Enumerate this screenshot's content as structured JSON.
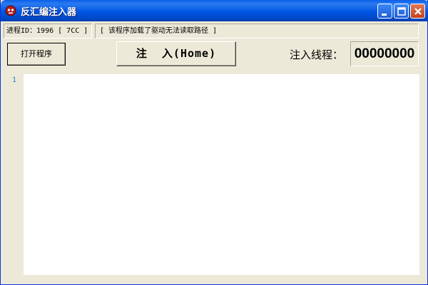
{
  "window": {
    "title": "反汇编注入器",
    "controls": {
      "minimize": "minimize-icon",
      "maximize": "maximize-icon",
      "close": "close-icon"
    }
  },
  "status": {
    "process_id": "进程ID：1996 [ 7CC ]",
    "message": "[ 该程序加载了驱动无法读取路径 ]"
  },
  "toolbar": {
    "open_label": "打开程序",
    "inject_label": "注  入(Home)",
    "thread_label": "注入线程：",
    "thread_value": "00000000"
  },
  "editor": {
    "line_numbers": [
      "1"
    ],
    "content": ""
  },
  "colors": {
    "titlebar": "#0054e3",
    "window_bg": "#ece9d8",
    "editor_bg": "#ffffff",
    "line_number": "#2b7ad8"
  }
}
